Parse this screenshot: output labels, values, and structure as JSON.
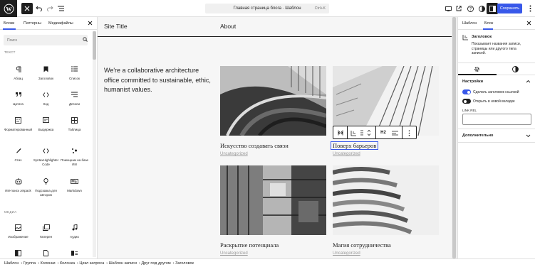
{
  "topbar": {
    "document_title": "Главная страница блога · Шаблон",
    "shortcut": "Ctrl+K",
    "save_label": "Сохранить"
  },
  "left_panel": {
    "tabs": [
      "Блоки",
      "Паттерны",
      "Медиафайлы"
    ],
    "active_tab": "Блоки",
    "search_placeholder": "Поиск",
    "categories": {
      "text": "ТЕКСТ",
      "media": "МЕДИА"
    },
    "text_blocks": [
      {
        "label": "Абзац",
        "icon": "paragraph-icon"
      },
      {
        "label": "Заголовок",
        "icon": "bookmark-icon"
      },
      {
        "label": "Список",
        "icon": "list-icon"
      },
      {
        "label": "Цитата",
        "icon": "quote-icon"
      },
      {
        "label": "Код",
        "icon": "code-icon"
      },
      {
        "label": "Детали",
        "icon": "details-icon"
      },
      {
        "label": "Форматированный",
        "icon": "preformatted-icon"
      },
      {
        "label": "Выдержка",
        "icon": "pullquote-icon"
      },
      {
        "label": "Таблица",
        "icon": "table-icon"
      },
      {
        "label": "Стих",
        "icon": "verse-icon"
      },
      {
        "label": "SyntaxHighlighter Code",
        "icon": "syntax-code-icon"
      },
      {
        "label": "Помощник на базе ИИ",
        "icon": "ai-assistant-icon"
      },
      {
        "label": "ИИ-поиск Jetpack",
        "icon": "robot-icon"
      },
      {
        "label": "Подсказка для авторов",
        "icon": "lightbulb-icon"
      },
      {
        "label": "Markdown",
        "icon": "markdown-icon"
      }
    ],
    "media_blocks": [
      {
        "label": "Изображение",
        "icon": "image-icon"
      },
      {
        "label": "Галерея",
        "icon": "gallery-icon"
      },
      {
        "label": "Аудио",
        "icon": "audio-icon"
      },
      {
        "label": "",
        "icon": "cover-icon"
      },
      {
        "label": "",
        "icon": "file-icon"
      },
      {
        "label": "",
        "icon": "media-text-icon"
      }
    ]
  },
  "canvas": {
    "site_title": "Site Title",
    "nav_item": "About",
    "hero_text": "We're a collaborative architecture office committed to sustainable, ethic, humanist values.",
    "posts": [
      {
        "title": "Искусство создавать связи",
        "category": "Uncategorized"
      },
      {
        "title": "Поверх барьеров",
        "category": "Uncategorized",
        "selected": true
      },
      {
        "title": "Раскрытие потенциала",
        "category": "Uncategorized"
      },
      {
        "title": "Магия сотрудничества",
        "category": "Uncategorized"
      }
    ],
    "block_toolbar": {
      "heading_level": "H2"
    }
  },
  "right_panel": {
    "tabs": [
      "Шаблон",
      "Блок"
    ],
    "active_tab": "Блок",
    "block_name": "Заголовок",
    "block_description": "Показывает названия записи, страницы или другого типа записей.",
    "settings_heading": "Настройки",
    "toggles": [
      {
        "label": "Сделать заголовок ссылкой",
        "on": true
      },
      {
        "label": "Открыть в новой вкладке",
        "on": false
      }
    ],
    "rel_label": "LINK REL",
    "rel_value": "",
    "advanced_heading": "Дополнительно",
    "accent_color": "#3858e9"
  },
  "breadcrumbs": [
    "Шаблон",
    "Группа",
    "Колонки",
    "Колонка",
    "Цикл запроса",
    "Шаблон записи",
    "Друг под другом",
    "Заголовок"
  ]
}
